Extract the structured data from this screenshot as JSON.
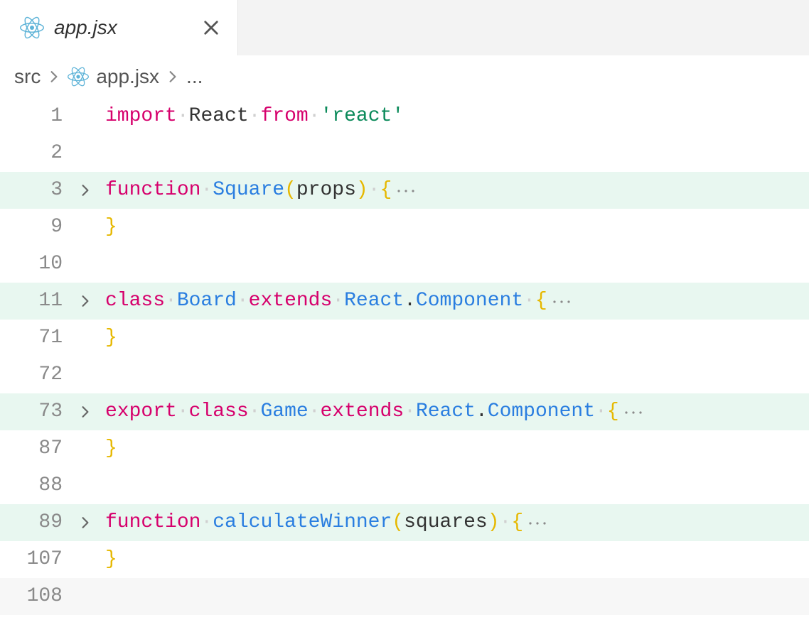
{
  "tab": {
    "filename": "app.jsx",
    "icon": "react-icon"
  },
  "breadcrumb": {
    "segments": [
      "src",
      "app.jsx",
      "..."
    ],
    "file_icon": "react-icon"
  },
  "editor": {
    "lines": [
      {
        "num": "1",
        "fold": false,
        "highlight": false,
        "tokens": [
          [
            "kw",
            "import"
          ],
          [
            "ws",
            "·"
          ],
          [
            "ident",
            "React"
          ],
          [
            "ws",
            "·"
          ],
          [
            "kw",
            "from"
          ],
          [
            "ws",
            "·"
          ],
          [
            "str",
            "'react'"
          ]
        ]
      },
      {
        "num": "2",
        "fold": false,
        "highlight": false,
        "tokens": []
      },
      {
        "num": "3",
        "fold": true,
        "highlight": true,
        "tokens": [
          [
            "kw",
            "function"
          ],
          [
            "ws",
            "·"
          ],
          [
            "def",
            "Square"
          ],
          [
            "paren",
            "("
          ],
          [
            "ident",
            "props"
          ],
          [
            "paren",
            ")"
          ],
          [
            "ws",
            "·"
          ],
          [
            "brace",
            "{"
          ],
          [
            "dots",
            "⋯"
          ]
        ]
      },
      {
        "num": "9",
        "fold": false,
        "highlight": false,
        "tokens": [
          [
            "brace",
            "}"
          ]
        ]
      },
      {
        "num": "10",
        "fold": false,
        "highlight": false,
        "tokens": []
      },
      {
        "num": "11",
        "fold": true,
        "highlight": true,
        "tokens": [
          [
            "kw",
            "class"
          ],
          [
            "ws",
            "·"
          ],
          [
            "def",
            "Board"
          ],
          [
            "ws",
            "·"
          ],
          [
            "kw",
            "extends"
          ],
          [
            "ws",
            "·"
          ],
          [
            "type",
            "React"
          ],
          [
            "punct",
            "."
          ],
          [
            "type",
            "Component"
          ],
          [
            "ws",
            "·"
          ],
          [
            "brace",
            "{"
          ],
          [
            "dots",
            "⋯"
          ]
        ]
      },
      {
        "num": "71",
        "fold": false,
        "highlight": false,
        "tokens": [
          [
            "brace",
            "}"
          ]
        ]
      },
      {
        "num": "72",
        "fold": false,
        "highlight": false,
        "tokens": []
      },
      {
        "num": "73",
        "fold": true,
        "highlight": true,
        "tokens": [
          [
            "kw",
            "export"
          ],
          [
            "ws",
            "·"
          ],
          [
            "kw",
            "class"
          ],
          [
            "ws",
            "·"
          ],
          [
            "def",
            "Game"
          ],
          [
            "ws",
            "·"
          ],
          [
            "kw",
            "extends"
          ],
          [
            "ws",
            "·"
          ],
          [
            "type",
            "React"
          ],
          [
            "punct",
            "."
          ],
          [
            "type",
            "Component"
          ],
          [
            "ws",
            "·"
          ],
          [
            "brace",
            "{"
          ],
          [
            "dots",
            "⋯"
          ]
        ]
      },
      {
        "num": "87",
        "fold": false,
        "highlight": false,
        "tokens": [
          [
            "brace",
            "}"
          ]
        ]
      },
      {
        "num": "88",
        "fold": false,
        "highlight": false,
        "tokens": []
      },
      {
        "num": "89",
        "fold": true,
        "highlight": true,
        "tokens": [
          [
            "kw",
            "function"
          ],
          [
            "ws",
            "·"
          ],
          [
            "def",
            "calculateWinner"
          ],
          [
            "paren",
            "("
          ],
          [
            "ident",
            "squares"
          ],
          [
            "paren",
            ")"
          ],
          [
            "ws",
            "·"
          ],
          [
            "brace",
            "{"
          ],
          [
            "dots",
            "⋯"
          ]
        ]
      },
      {
        "num": "107",
        "fold": false,
        "highlight": false,
        "tokens": [
          [
            "brace",
            "}"
          ]
        ]
      },
      {
        "num": "108",
        "fold": false,
        "highlight": false,
        "current": true,
        "tokens": []
      }
    ]
  }
}
